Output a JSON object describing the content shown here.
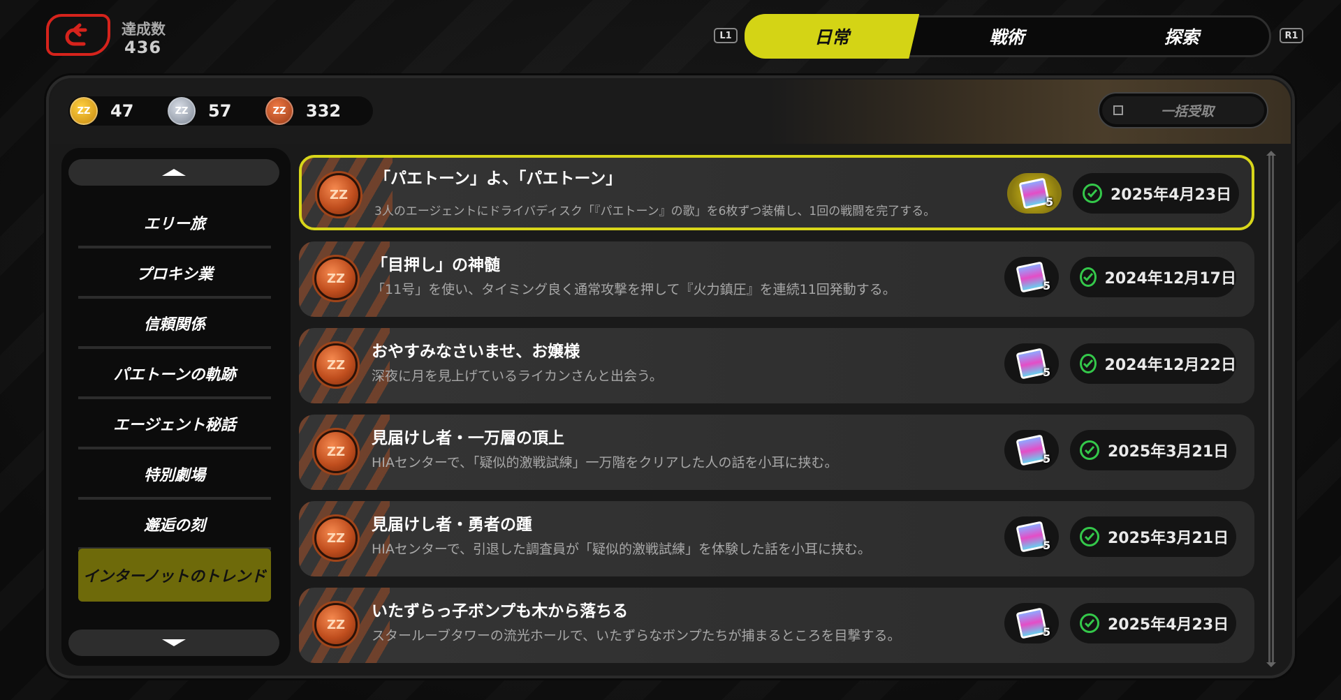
{
  "header": {
    "achievement_count_label": "達成数",
    "achievement_count_value": "436",
    "shoulder_left": "L1",
    "shoulder_right": "R1",
    "tabs": [
      {
        "label": "日常",
        "active": true
      },
      {
        "label": "戦術",
        "active": false
      },
      {
        "label": "探索",
        "active": false
      }
    ]
  },
  "currencies": [
    {
      "icon": "gold-medal-icon",
      "value": "47"
    },
    {
      "icon": "silver-medal-icon",
      "value": "57"
    },
    {
      "icon": "bronze-medal-icon",
      "value": "332"
    }
  ],
  "claim_all_label": "一括受取",
  "sidebar": {
    "items": [
      {
        "label": "エリー旅",
        "active": false
      },
      {
        "label": "プロキシ業",
        "active": false
      },
      {
        "label": "信頼関係",
        "active": false
      },
      {
        "label": "パエトーンの軌跡",
        "active": false
      },
      {
        "label": "エージェント秘話",
        "active": false
      },
      {
        "label": "特別劇場",
        "active": false
      },
      {
        "label": "邂逅の刻",
        "active": false
      },
      {
        "label": "インターノットのトレンド",
        "active": true
      }
    ]
  },
  "achievements": [
    {
      "title": "「パエトーン」よ、「パエトーン」",
      "description": "3人のエージェントにドライバディスク「『パエトーン』の歌」を6枚ずつ装備し、1回の戦闘を完了する。",
      "reward_count": "5",
      "completed_date": "2025年4月23日",
      "selected": true
    },
    {
      "title": "「目押し」の神髄",
      "description": "「11号」を使い、タイミング良く通常攻撃を押して『火力鎮圧』を連続11回発動する。",
      "reward_count": "5",
      "completed_date": "2024年12月17日",
      "selected": false
    },
    {
      "title": "おやすみなさいませ、お嬢様",
      "description": "深夜に月を見上げているライカンさんと出会う。",
      "reward_count": "5",
      "completed_date": "2024年12月22日",
      "selected": false
    },
    {
      "title": "見届けし者・一万層の頂上",
      "description": "HIAセンターで、「疑似的激戦試練」一万階をクリアした人の話を小耳に挟む。",
      "reward_count": "5",
      "completed_date": "2025年3月21日",
      "selected": false
    },
    {
      "title": "見届けし者・勇者の踵",
      "description": "HIAセンターで、引退した調査員が「疑似的激戦試練」を体験した話を小耳に挟む。",
      "reward_count": "5",
      "completed_date": "2025年3月21日",
      "selected": false
    },
    {
      "title": "いたずらっ子ボンプも木から落ちる",
      "description": "スタールーブタワーの流光ホールで、いたずらなボンプたちが捕まるところを目撃する。",
      "reward_count": "5",
      "completed_date": "2025年4月23日",
      "selected": false
    }
  ],
  "colors": {
    "accent_yellow": "#d4d415",
    "back_red": "#d6231c",
    "check_green": "#34c84a",
    "sidebar_active": "#6e6a0a"
  }
}
